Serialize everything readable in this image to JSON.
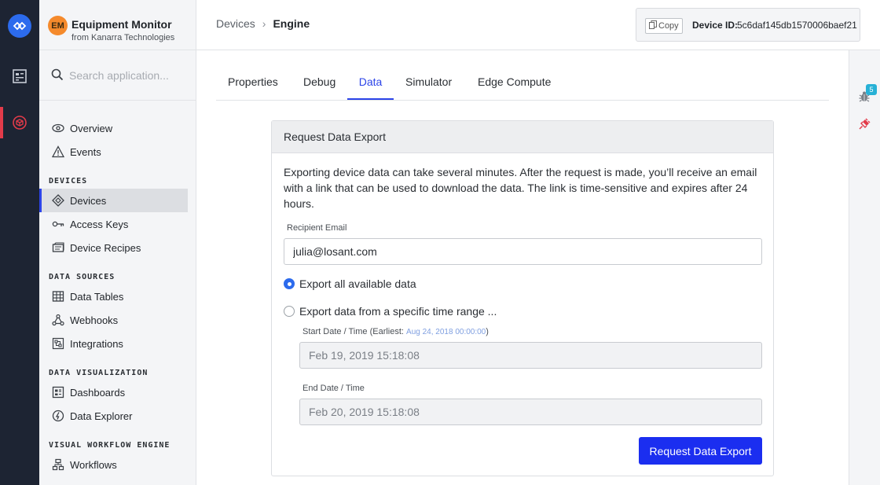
{
  "app": {
    "avatar_initials": "EM",
    "name": "Equipment Monitor",
    "org": "from Kanarra Technologies"
  },
  "search": {
    "placeholder": "Search application..."
  },
  "sidebar": {
    "top_items": [
      {
        "label": "Overview",
        "icon": "eye-icon"
      },
      {
        "label": "Events",
        "icon": "warning-icon"
      }
    ],
    "sections": [
      {
        "title": "DEVICES",
        "items": [
          {
            "label": "Devices",
            "icon": "device-icon",
            "active": true
          },
          {
            "label": "Access Keys",
            "icon": "key-icon"
          },
          {
            "label": "Device Recipes",
            "icon": "recipe-icon"
          }
        ]
      },
      {
        "title": "DATA SOURCES",
        "items": [
          {
            "label": "Data Tables",
            "icon": "table-icon"
          },
          {
            "label": "Webhooks",
            "icon": "webhook-icon"
          },
          {
            "label": "Integrations",
            "icon": "integration-icon"
          }
        ]
      },
      {
        "title": "DATA VISUALIZATION",
        "items": [
          {
            "label": "Dashboards",
            "icon": "dashboard-icon"
          },
          {
            "label": "Data Explorer",
            "icon": "explorer-icon"
          }
        ]
      },
      {
        "title": "VISUAL WORKFLOW ENGINE",
        "items": [
          {
            "label": "Workflows",
            "icon": "workflow-icon"
          }
        ]
      }
    ]
  },
  "breadcrumb": {
    "parent": "Devices",
    "separator": "›",
    "current": "Engine"
  },
  "device_id": {
    "copy_label": "Copy",
    "label": "Device ID:",
    "value": "5c6daf145db1570006baef21"
  },
  "tabs": [
    "Properties",
    "Debug",
    "Data",
    "Simulator",
    "Edge Compute"
  ],
  "active_tab": "Data",
  "right_rail": {
    "badge_count": "5"
  },
  "export": {
    "title": "Request Data Export",
    "description": "Exporting device data can take several minutes. After the request is made, you’ll receive an email with a link that can be used to download the data. The link is time-sensitive and expires after 24 hours.",
    "recipient_label": "Recipient Email",
    "recipient_value": "julia@losant.com",
    "option_all": "Export all available data",
    "option_range": "Export data from a specific time range ...",
    "selected_option": "all",
    "start_label": "Start Date / Time (Earliest: ",
    "start_earliest": "Aug 24, 2018 00:00:00",
    "start_label_close": ")",
    "start_value": "Feb 19, 2019 15:18:08",
    "end_label": "End Date / Time",
    "end_value": "Feb 20, 2019 15:18:08",
    "submit_label": "Request Data Export"
  },
  "colors": {
    "accent": "#2c44e8",
    "rail": "#1d2433",
    "active_rail": "#e23b4a",
    "avatar": "#f58a2c",
    "submit": "#1b2ef0"
  }
}
